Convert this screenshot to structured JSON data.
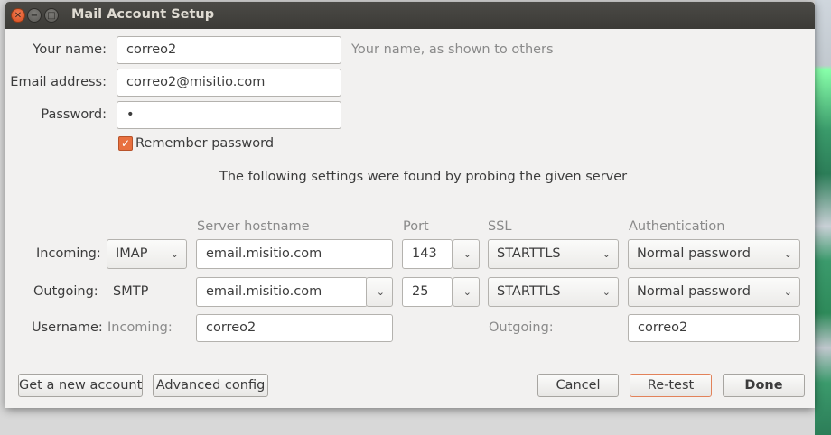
{
  "window": {
    "title": "Mail Account Setup",
    "buttons": [
      "close",
      "minimize",
      "maximize"
    ]
  },
  "identity": {
    "name_label": "Your name:",
    "name_value": "correo2",
    "name_hint": "Your name, as shown to others",
    "email_label": "Email address:",
    "email_value": "correo2@misitio.com",
    "password_label": "Password:",
    "password_value": "•",
    "remember_label": "Remember password",
    "remember_checked": true
  },
  "probe_message": "The following settings were found by probing the given server",
  "columns": {
    "hostname": "Server hostname",
    "port": "Port",
    "ssl": "SSL",
    "auth": "Authentication"
  },
  "incoming": {
    "label": "Incoming:",
    "protocol": "IMAP",
    "hostname": "email.misitio.com",
    "port": "143",
    "ssl": "STARTTLS",
    "auth": "Normal password"
  },
  "outgoing": {
    "label": "Outgoing:",
    "protocol": "SMTP",
    "hostname": "email.misitio.com",
    "port": "25",
    "ssl": "STARTTLS",
    "auth": "Normal password"
  },
  "username": {
    "label": "Username:",
    "incoming_label": "Incoming:",
    "incoming_value": "correo2",
    "outgoing_label": "Outgoing:",
    "outgoing_value": "correo2"
  },
  "actions": {
    "new_account": "Get a new account",
    "advanced": "Advanced config",
    "cancel": "Cancel",
    "retest": "Re-test",
    "done": "Done"
  },
  "colors": {
    "accent": "#e8703f",
    "titlebar": "#3c3b37",
    "window_bg": "#f2f1f0"
  }
}
